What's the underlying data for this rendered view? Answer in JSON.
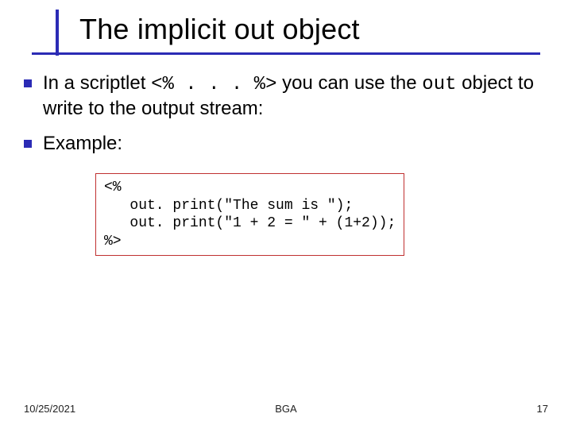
{
  "title": "The implicit out object",
  "bullets": [
    {
      "pre": "In a scriptlet ",
      "code1": "<% . . . %>",
      "mid": " you can use the ",
      "code2": "out",
      "post": " object to write to the output stream:"
    },
    {
      "pre": "Example:",
      "code1": "",
      "mid": "",
      "code2": "",
      "post": ""
    }
  ],
  "code_block": "<%\n   out. print(\"The sum is \");\n   out. print(\"1 + 2 = \" + (1+2));\n%>",
  "footer": {
    "date": "10/25/2021",
    "author": "BGA",
    "page": "17"
  }
}
